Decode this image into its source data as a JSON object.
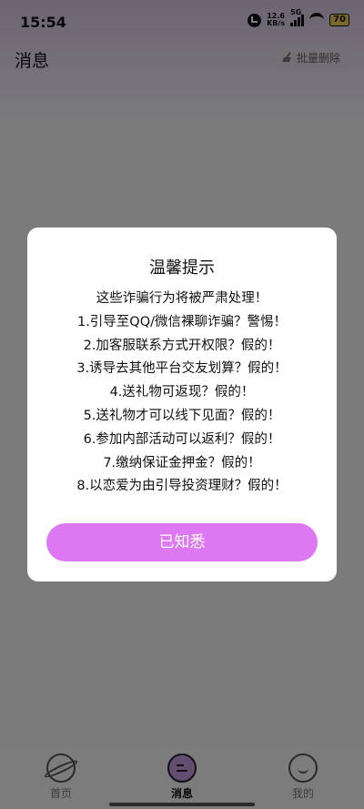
{
  "status_bar": {
    "time": "15:54",
    "net_speed_value": "12.6",
    "net_speed_unit": "KB/s",
    "network_type": "5G",
    "battery": "70"
  },
  "header": {
    "title": "消息",
    "batch_delete_label": "批量删除"
  },
  "dialog": {
    "title": "温馨提示",
    "lines": [
      "这些诈骗行为将被严肃处理！",
      "1.引导至QQ/微信裸聊诈骗？警惕！",
      "2.加客服联系方式开权限？假的！",
      "3.诱导去其他平台交友划算？假的！",
      "4.送礼物可返现？假的！",
      "5.送礼物才可以线下见面？假的！",
      "6.参加内部活动可以返利？假的！",
      "7.缴纳保证金押金？假的！",
      "8.以恋爱为由引导投资理财？假的！"
    ],
    "confirm_label": "已知悉",
    "accent_color": "#dd77f2"
  },
  "bottom_nav": {
    "items": [
      {
        "label": "首页",
        "icon": "planet-icon"
      },
      {
        "label": "消息",
        "icon": "message-icon",
        "active": true
      },
      {
        "label": "我的",
        "icon": "smile-icon"
      }
    ]
  }
}
